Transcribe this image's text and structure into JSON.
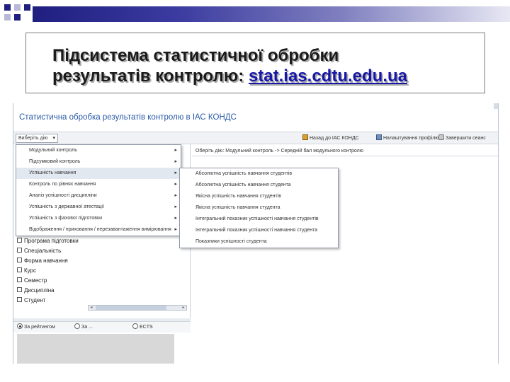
{
  "slide": {
    "title_line1": "Підсистема статистичної обробки",
    "title_line2_prefix": "результатів контролю: ",
    "title_link": "stat.ias.cdtu.edu.ua",
    "colors": {
      "band_dark": "#1f1f80",
      "band_light": "#e8e8f4",
      "link": "#1616a8"
    }
  },
  "app": {
    "title": "Статистична обробка результатів контролю в ІАС КОНДС",
    "toolbar": {
      "select_button": "Виберіть дію",
      "items": [
        {
          "icon": "home-icon",
          "label": "Назад до ІАС КОНДС"
        },
        {
          "icon": "settings-icon",
          "label": "Налаштування профілю"
        },
        {
          "icon": "lock-icon",
          "label": "Завершити сеанс"
        }
      ]
    },
    "breadcrumb": "Оберіть дію: Модульний контроль -> Середній бал модульного контролю",
    "menu": [
      {
        "label": "Модульний контроль",
        "active": false
      },
      {
        "label": "Підсумковий контроль",
        "active": false
      },
      {
        "label": "Успішність навчання",
        "active": true
      },
      {
        "label": "Контроль по рівнях навчання",
        "active": false
      },
      {
        "label": "Аналіз успішності дисципліни",
        "active": false
      },
      {
        "label": "Успішність з державної атестації",
        "active": false
      },
      {
        "label": "Успішність з фахової підготовки",
        "active": false
      },
      {
        "label": "Відображення / приховання / перезавантаження вимірювання",
        "active": false
      }
    ],
    "submenu": [
      "Абсолютна успішність навчання студентів",
      "Абсолютна успішність навчання студента",
      "Якісна успішність навчання студентів",
      "Якісна успішність навчання студента",
      "Інтегральний показник успішності навчання студентів",
      "Інтегральний показник успішності навчання студента",
      "Показники успішності студента"
    ],
    "checklist": [
      "Програма підготовки",
      "Спеціальність",
      "Форма навчання",
      "Курс",
      "Семестр",
      "Дисципліна",
      "Студент"
    ],
    "radios": [
      {
        "label": "За рейтингом",
        "selected": true
      },
      {
        "label": "За ...",
        "selected": false
      },
      {
        "label": "ECTS",
        "selected": false
      }
    ],
    "colors": {
      "app_title": "#2a5ba8",
      "menu_active": "#e2e8f0"
    }
  }
}
